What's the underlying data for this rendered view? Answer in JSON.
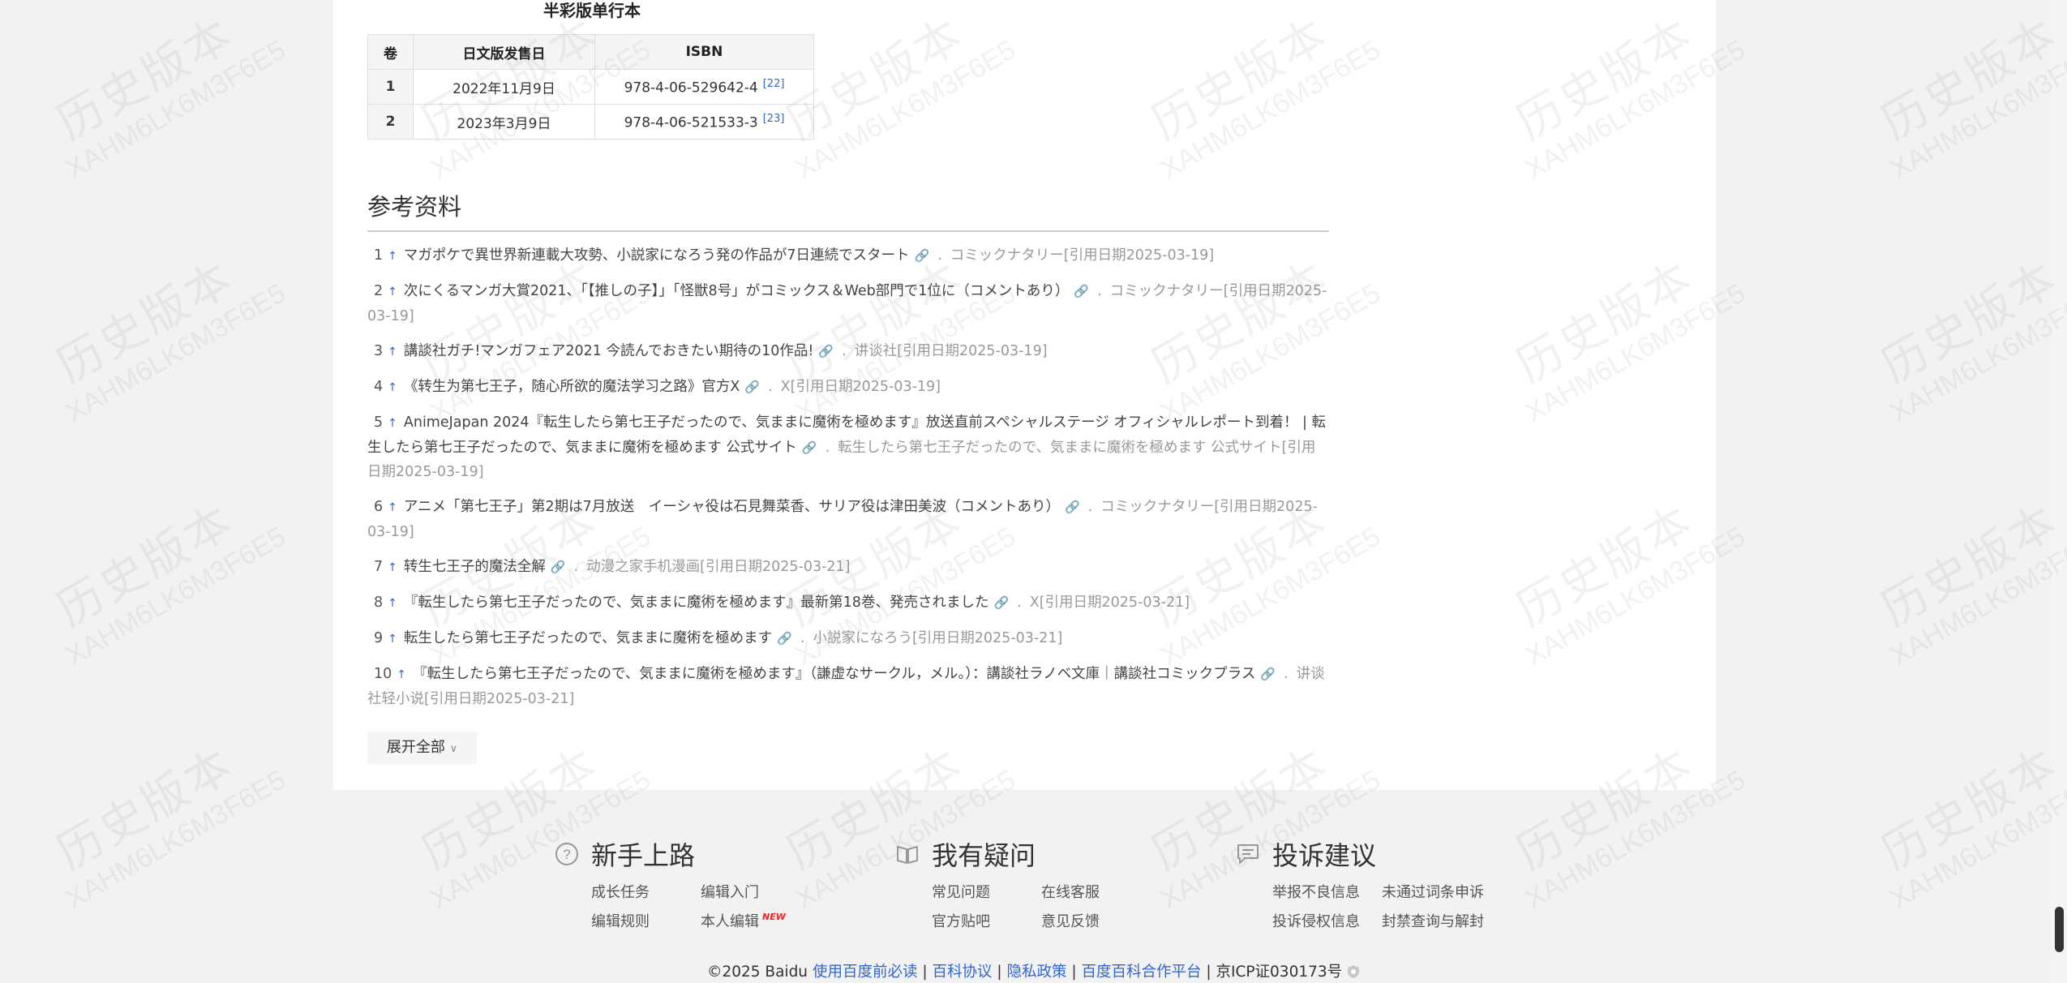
{
  "volume_table": {
    "title": "半彩版单行本",
    "headers": [
      "卷",
      "日文版发售日",
      "ISBN"
    ],
    "rows": [
      {
        "vol": "1",
        "date": "2022年11月9日",
        "isbn": "978-4-06-529642-4",
        "ref": "[22]"
      },
      {
        "vol": "2",
        "date": "2023年3月9日",
        "isbn": "978-4-06-521533-3",
        "ref": "[23]"
      }
    ]
  },
  "references": {
    "title": "参考资料",
    "items": [
      {
        "num": "1",
        "text": "マガポケで異世界新連載大攻勢、小説家になろう発の作品が7日連続でスタート",
        "source": "コミックナタリー[引用日期2025-03-19]"
      },
      {
        "num": "2",
        "text": "次にくるマンガ大賞2021、「【推しの子】」「怪獣8号」がコミックス＆Web部門で1位に（コメントあり）",
        "source": "コミックナタリー[引用日期2025-03-19]"
      },
      {
        "num": "3",
        "text": "講談社ガチ!マンガフェア2021 今読んでおきたい期待の10作品!",
        "source": "讲谈社[引用日期2025-03-19]"
      },
      {
        "num": "4",
        "text": "《转生为第七王子，随心所欲的魔法学习之路》官方X",
        "source": "X[引用日期2025-03-19]"
      },
      {
        "num": "5",
        "text": "AnimeJapan 2024『転生したら第七王子だったので、気ままに魔術を極めます』放送直前スペシャルステージ オフィシャルレポート到着！ | 転生したら第七王子だったので、気ままに魔術を極めます 公式サイト",
        "source": "転生したら第七王子だったので、気ままに魔術を極めます 公式サイト[引用日期2025-03-19]"
      },
      {
        "num": "6",
        "text": "アニメ「第七王子」第2期は7月放送　イーシャ役は石見舞菜香、サリア役は津田美波（コメントあり）",
        "source": "コミックナタリー[引用日期2025-03-19]"
      },
      {
        "num": "7",
        "text": "转生七王子的魔法全解",
        "source": "动漫之家手机漫画[引用日期2025-03-21]"
      },
      {
        "num": "8",
        "text": "『転生したら第七王子だったので、気ままに魔術を極めます』最新第18巻、発売されました",
        "source": "X[引用日期2025-03-21]"
      },
      {
        "num": "9",
        "text": "転生したら第七王子だったので、気ままに魔術を極めます",
        "source": "小説家になろう[引用日期2025-03-21]"
      },
      {
        "num": "10",
        "text": "『転生したら第七王子だったので、気ままに魔術を極めます』（謙虚なサークル，メル。）：講談社ラノベ文庫｜講談社コミックプラス",
        "source": "讲谈社轻小说[引用日期2025-03-21]"
      }
    ],
    "expand_label": "展开全部"
  },
  "footer": {
    "columns": [
      {
        "title": "新手上路",
        "icon": "question-circle-icon",
        "links": [
          "成长任务",
          "编辑入门",
          "编辑规则",
          "本人编辑"
        ]
      },
      {
        "title": "我有疑问",
        "icon": "open-book-icon",
        "links": [
          "常见问题",
          "在线客服",
          "官方贴吧",
          "意见反馈"
        ]
      },
      {
        "title": "投诉建议",
        "icon": "chat-bubble-icon",
        "links": [
          "举报不良信息",
          "未通过词条申诉",
          "投诉侵权信息",
          "封禁查询与解封"
        ]
      }
    ],
    "new_badge": "NEW",
    "copyright": "©2025 Baidu",
    "links": [
      "使用百度前必读",
      "百科协议",
      "隐私政策",
      "百度百科合作平台"
    ],
    "icp": "京ICP证030173号"
  },
  "watermark": {
    "line1": "历史版本",
    "line2": "XAHM6LK6M3F6E5"
  }
}
